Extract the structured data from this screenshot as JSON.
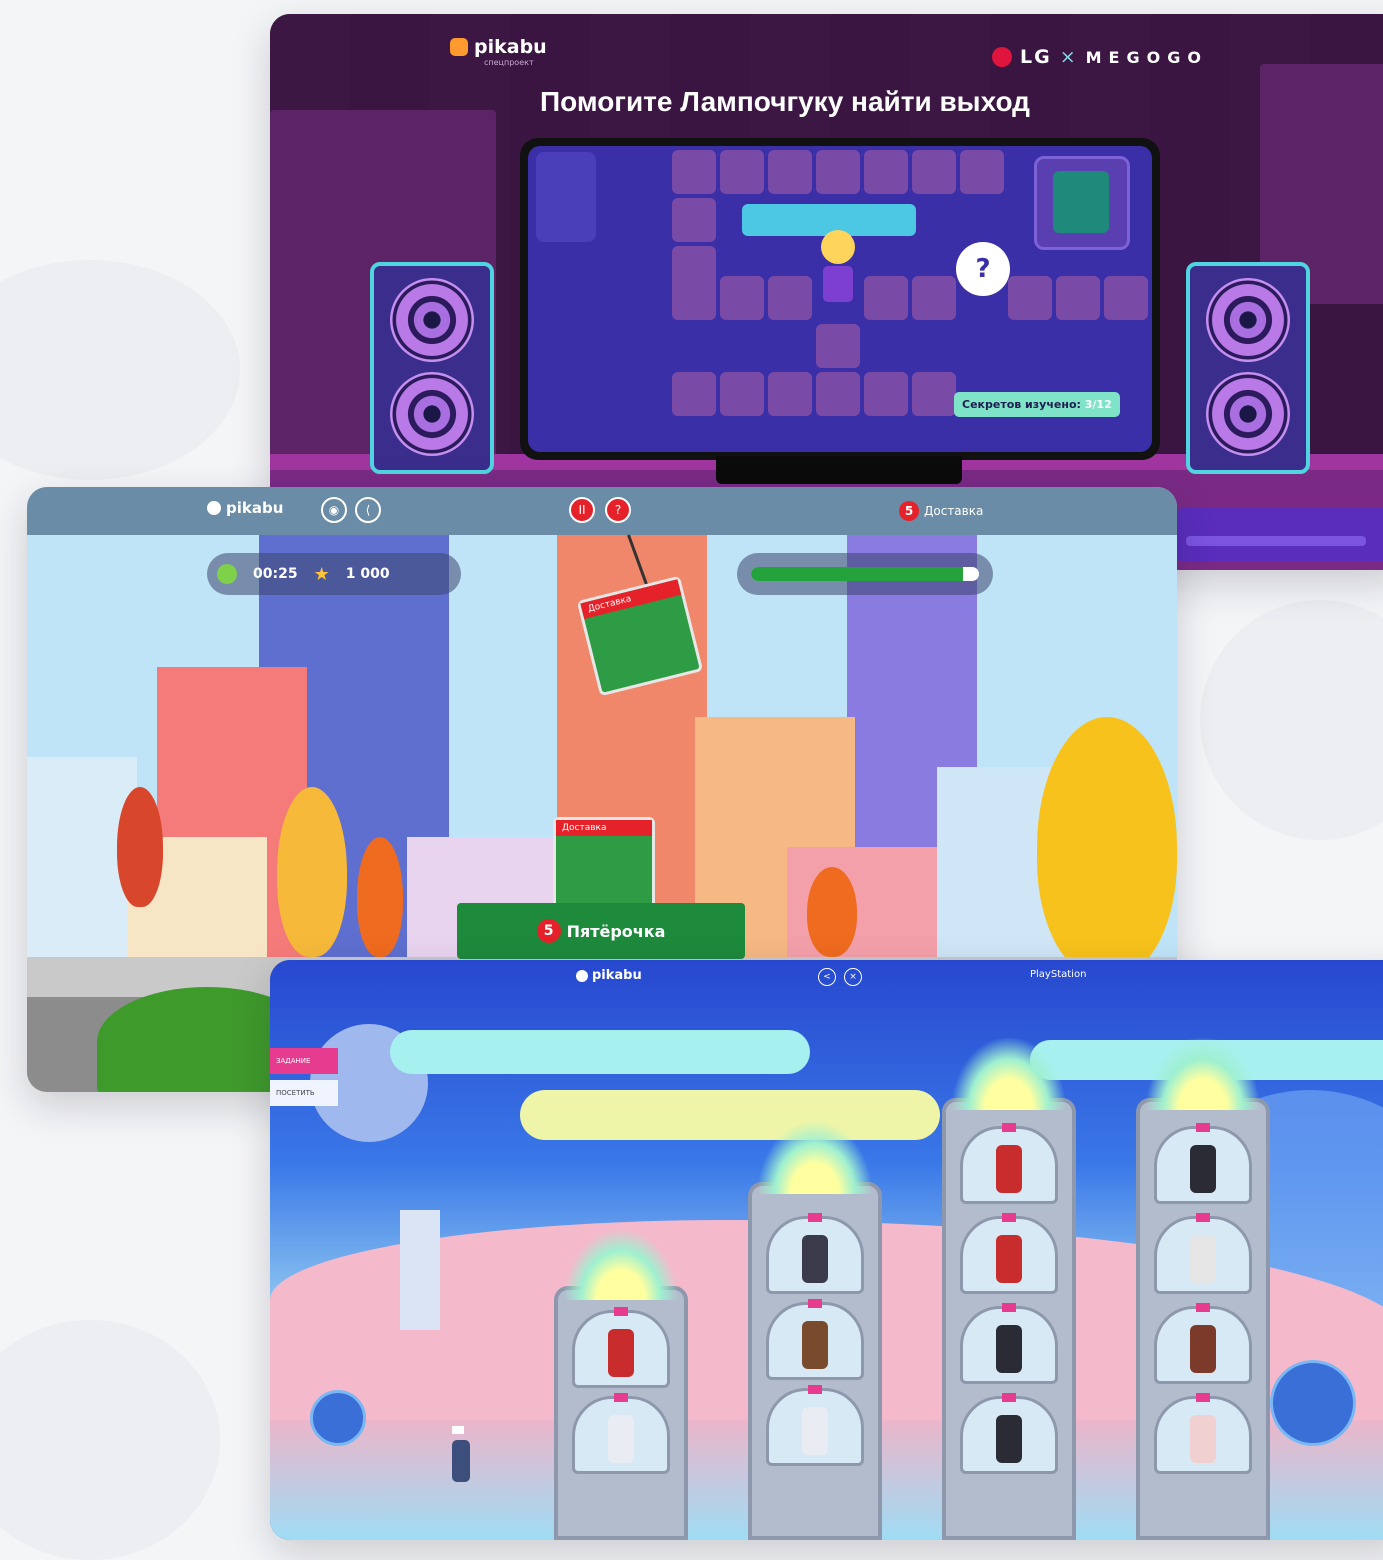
{
  "card1": {
    "logo_text": "pikabu",
    "logo_sub": "спецпроект",
    "partner_lg": "LG",
    "partner_x": "×",
    "partner_megogo": "MEGOGO",
    "title": "Помогите Лампочгуку найти выход",
    "question_mark": "?",
    "secrets_label": "Секретов изучено:",
    "secrets_count": "3/12"
  },
  "card2": {
    "logo_text": "pikabu",
    "sound_icon": "◉",
    "share_icon": "⟨",
    "pause_icon": "II",
    "help_icon": "?",
    "brand_five": "5",
    "brand_text": "Доставка",
    "timer": "00:25",
    "score": "1 000",
    "progress": 0.93,
    "box_label": "Доставка",
    "shop_five": "5",
    "shop_text": "Пятёрочка"
  },
  "card3": {
    "logo_text": "pikabu",
    "share_icon": "<",
    "close_icon": "×",
    "ps_text": "PlayStation",
    "tab_active": "ЗАДАНИЕ",
    "tab_plain": "ПОСЕТИТЬ"
  },
  "colors": {
    "lg_megogo_bg": "#3a1640",
    "pyaterochka_green": "#1e8a3c",
    "pyaterochka_red": "#e5222a",
    "playstation_bg": "#2a57d6",
    "accent_pink": "#e73b8f"
  }
}
